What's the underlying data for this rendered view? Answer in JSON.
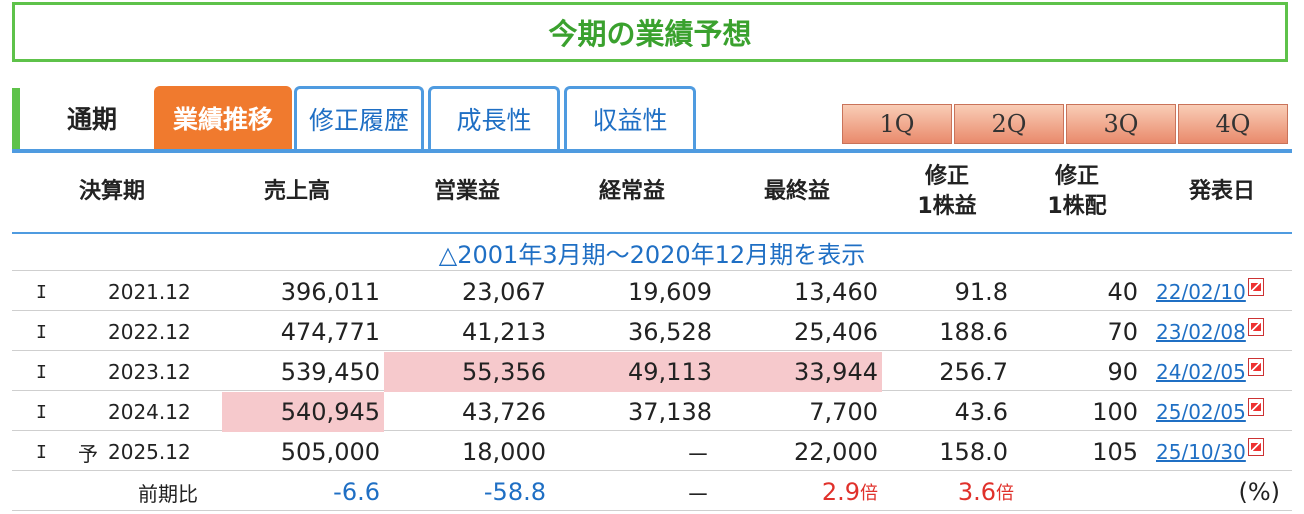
{
  "title": "今期の業績予想",
  "tabs": {
    "static_label": "通期",
    "items": [
      {
        "label": "業績推移",
        "active": true
      },
      {
        "label": "修正履歴",
        "active": false
      },
      {
        "label": "成長性",
        "active": false
      },
      {
        "label": "収益性",
        "active": false
      }
    ],
    "quarters": [
      "1Q",
      "2Q",
      "3Q",
      "4Q"
    ]
  },
  "columns": [
    "決算期",
    "売上高",
    "営業益",
    "経常益",
    "最終益",
    "修正\n1株益",
    "修正\n1株配",
    "発表日"
  ],
  "expand_label": "△2001年3月期〜2020年12月期を表示",
  "rows": [
    {
      "type": "I",
      "forecast": "",
      "period": "2021.12",
      "sales": "396,011",
      "op": "23,067",
      "ord": "19,609",
      "net": "13,460",
      "eps": "91.8",
      "dps": "40",
      "date": "22/02/10"
    },
    {
      "type": "I",
      "forecast": "",
      "period": "2022.12",
      "sales": "474,771",
      "op": "41,213",
      "ord": "36,528",
      "net": "25,406",
      "eps": "188.6",
      "dps": "70",
      "date": "23/02/08"
    },
    {
      "type": "I",
      "forecast": "",
      "period": "2023.12",
      "sales": "539,450",
      "op": "55,356",
      "ord": "49,113",
      "net": "33,944",
      "eps": "256.7",
      "dps": "90",
      "date": "24/02/05"
    },
    {
      "type": "I",
      "forecast": "",
      "period": "2024.12",
      "sales": "540,945",
      "op": "43,726",
      "ord": "37,138",
      "net": "7,700",
      "eps": "43.6",
      "dps": "100",
      "date": "25/02/05"
    },
    {
      "type": "I",
      "forecast": "予",
      "period": "2025.12",
      "sales": "505,000",
      "op": "18,000",
      "ord": "－",
      "net": "22,000",
      "eps": "158.0",
      "dps": "105",
      "date": "25/10/30"
    }
  ],
  "comparison": {
    "label": "前期比",
    "sales": "-6.6",
    "op": "-58.8",
    "ord": "－",
    "net": "2.9",
    "net_unit": "倍",
    "eps": "3.6",
    "eps_unit": "倍",
    "unit_note": "(%)"
  },
  "colors": {
    "green": "#5ec24a",
    "orange": "#f07a2e",
    "blue": "#4f9be0",
    "highlight": "#f6c9cc",
    "negative": "#1f6fc4",
    "positive": "#e0312b"
  },
  "icons": {
    "report": "pdf-icon"
  }
}
